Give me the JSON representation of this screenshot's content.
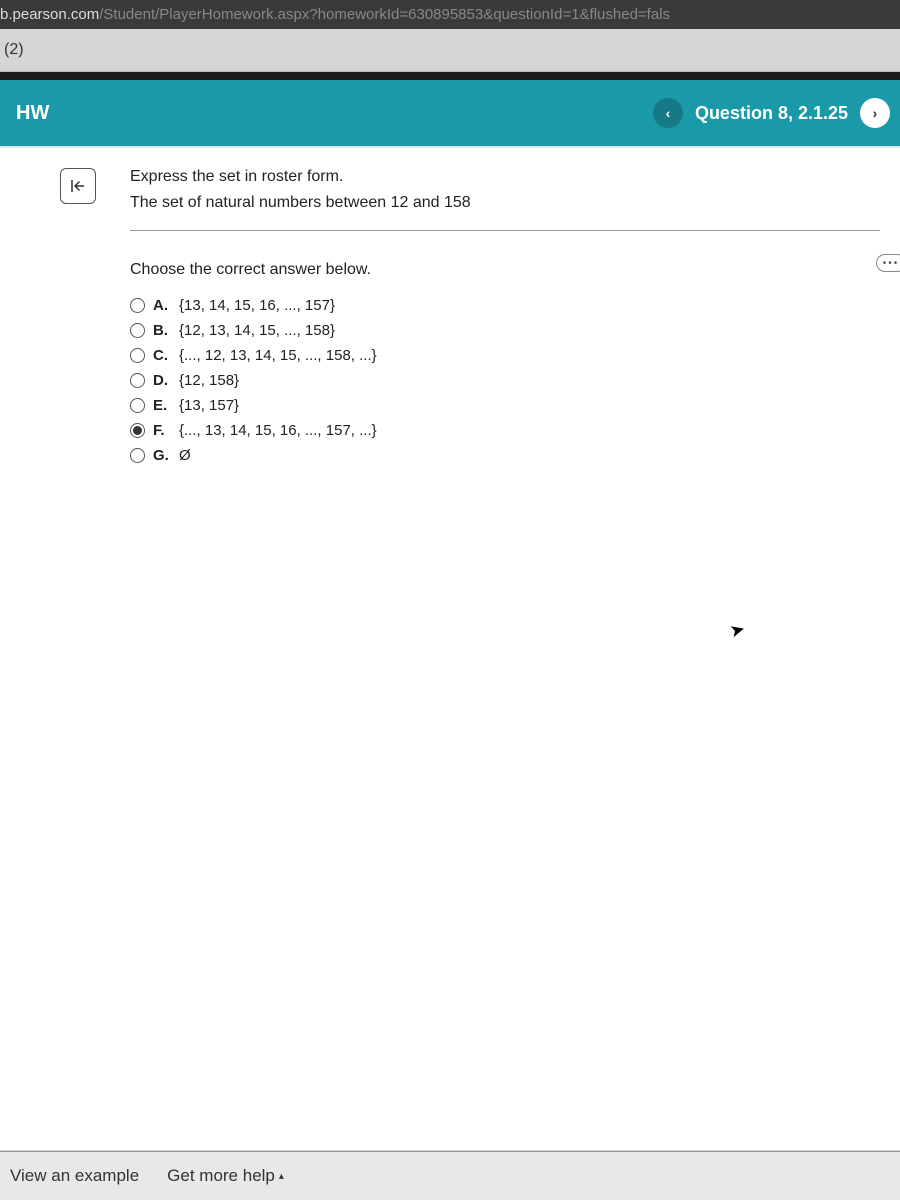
{
  "browser": {
    "url_host": "b.pearson.com",
    "url_path": "/Student/PlayerHomework.aspx?homeworkId=630895853&questionId=1&flushed=fals"
  },
  "tab": {
    "label": "(2)"
  },
  "header": {
    "title": "HW",
    "question_label": "Question 8, 2.1.25"
  },
  "prompt": {
    "line1": "Express the set in roster form.",
    "line2": "The set of natural numbers between 12 and 158"
  },
  "choose_label": "Choose the correct answer below.",
  "options": [
    {
      "letter": "A.",
      "text": "{13, 14, 15, 16, ..., 157}",
      "selected": false
    },
    {
      "letter": "B.",
      "text": "{12, 13, 14, 15, ..., 158}",
      "selected": false
    },
    {
      "letter": "C.",
      "text": "{..., 12, 13, 14, 15, ..., 158, ...}",
      "selected": false
    },
    {
      "letter": "D.",
      "text": "{12, 158}",
      "selected": false
    },
    {
      "letter": "E.",
      "text": "{13, 157}",
      "selected": false
    },
    {
      "letter": "F.",
      "text": "{..., 13, 14, 15, 16, ..., 157, ...}",
      "selected": true
    },
    {
      "letter": "G.",
      "text": "Ø",
      "selected": false
    }
  ],
  "footer": {
    "view_example": "View an example",
    "get_more_help": "Get more help"
  },
  "icons": {
    "prev": "‹",
    "next": "›",
    "more": "•••",
    "caret_up": "▴"
  }
}
